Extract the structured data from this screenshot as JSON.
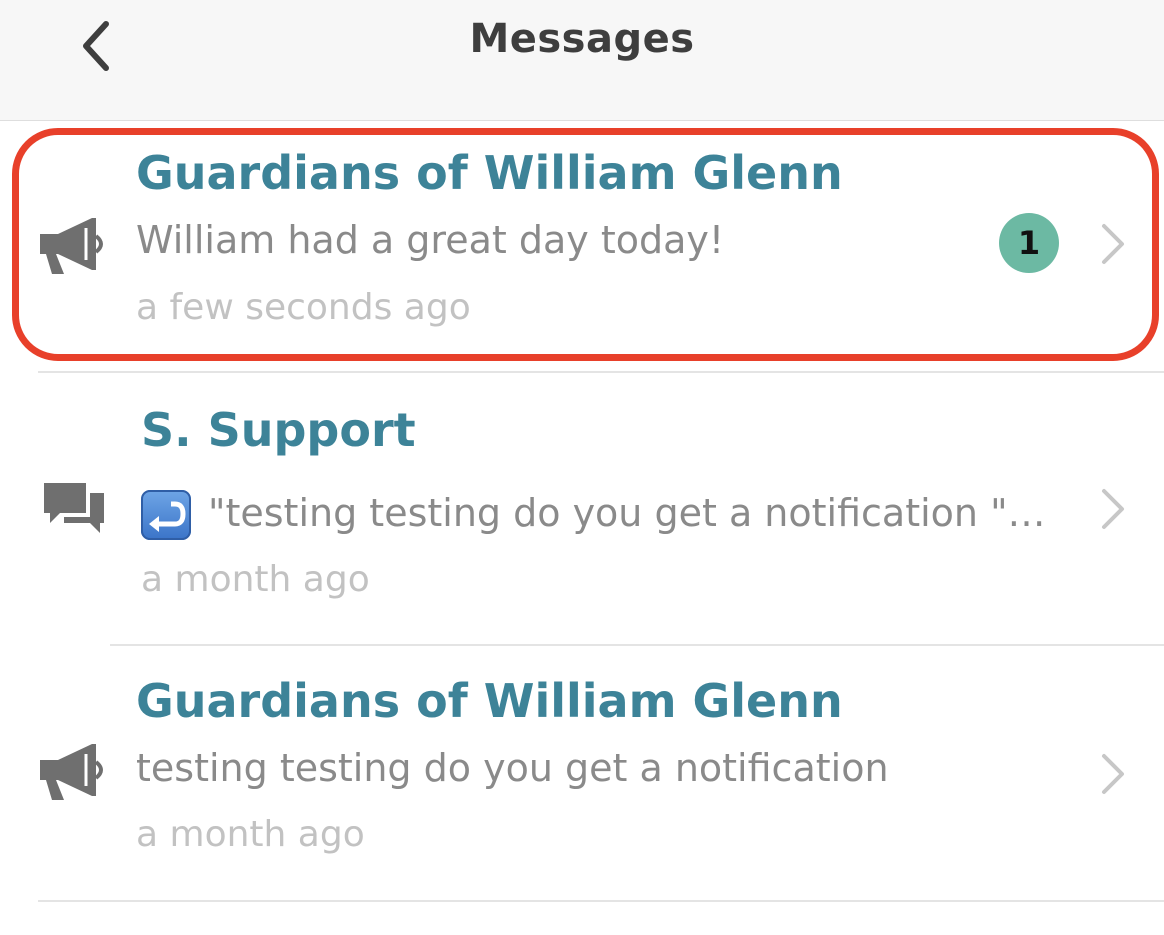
{
  "header": {
    "title": "Messages",
    "back_icon": "chevron-left-icon"
  },
  "messages": [
    {
      "title": "Guardians of William Glenn",
      "preview": "William had a great day today!",
      "time": "a few seconds ago",
      "icon": "megaphone-icon",
      "unread_count": "1",
      "highlighted": true
    },
    {
      "title": "S. Support",
      "preview": "\"testing testing do you get a notification \"…",
      "time": "a month ago",
      "icon": "chat-bubbles-icon",
      "preview_prefix_icon": "reply-arrow-emoji"
    },
    {
      "title": "Guardians of William Glenn",
      "preview": "testing testing do you get a notification",
      "time": "a month ago",
      "icon": "megaphone-icon"
    }
  ],
  "colors": {
    "title": "#3d8398",
    "preview": "#8a8a8a",
    "time": "#c2c2c2",
    "badge": "#6cb9a3",
    "highlight": "#e8402a",
    "header_bg": "#f7f7f7"
  }
}
